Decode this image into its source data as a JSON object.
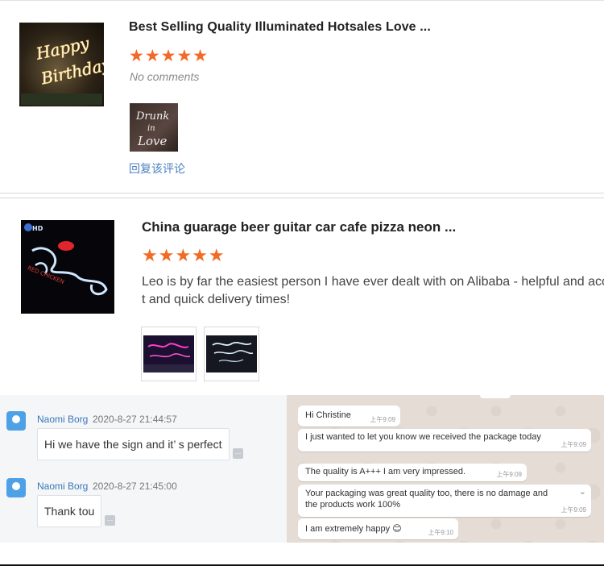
{
  "reviews": [
    {
      "title": "Best Selling Quality Illuminated Hotsales Love ...",
      "stars": "★★★★★",
      "rating": 5,
      "comment": "No comments",
      "thumbnail_text": "Happy Birthday",
      "photo_text": "Drunk in Love",
      "reply_label": "回复该评论"
    },
    {
      "title": "China guarage beer guitar car cafe pizza neon ...",
      "stars": "★★★★★",
      "rating": 5,
      "comment_line1": "Leo is by far the easiest person I have ever dealt with on Alibaba - helpful and acc",
      "comment_line2": "t and quick delivery times!"
    }
  ],
  "chat_left": {
    "messages": [
      {
        "sender": "Naomi Borg",
        "timestamp": "2020-8-27 21:44:57",
        "text": "Hi we have the sign and it’ s perfect"
      },
      {
        "sender": "Naomi Borg",
        "timestamp": "2020-8-27 21:45:00",
        "text": "Thank tou"
      }
    ],
    "more_icon": "..."
  },
  "chat_right": {
    "messages": [
      {
        "text": "Hi Christine",
        "time": "上午9:09"
      },
      {
        "text": "I just wanted to let you know we received the package today",
        "time": "上午9:09"
      },
      {
        "text": "The quality is A+++ I am very impressed.",
        "time": "上午9:09"
      },
      {
        "text_line1": "Your packaging was great quality too, there is no damage and",
        "text_line2": "the products work 100%",
        "time": "上午9:09"
      },
      {
        "text": "I am extremely happy 😊",
        "time": "上午9:10"
      }
    ]
  },
  "colors": {
    "star": "#f26a24",
    "link": "#4a7fc1",
    "sender": "#3a76b8",
    "wa_background": "#e5ddd5"
  }
}
